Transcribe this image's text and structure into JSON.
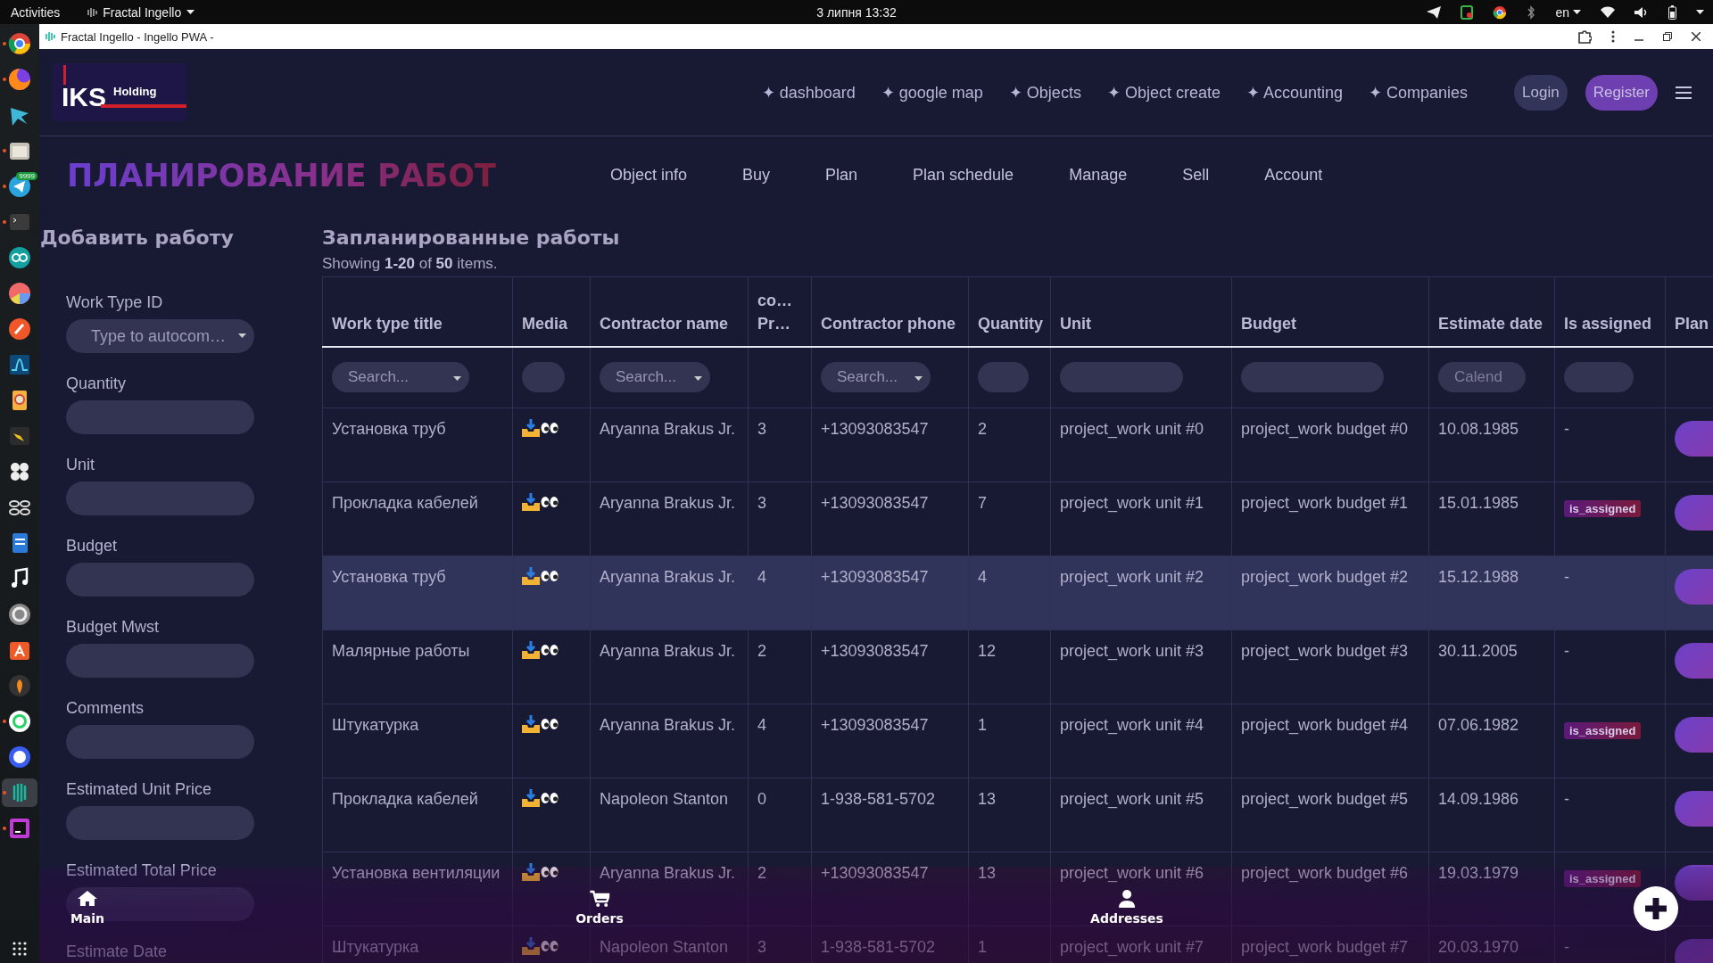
{
  "top_bar": {
    "activities": "Activities",
    "app_menu": "Fractal Ingello",
    "clock": "3 липня  13:32",
    "language": "en"
  },
  "dock": {
    "badge": "9999",
    "items": [
      {
        "running": true,
        "selected": false
      },
      {
        "running": true,
        "selected": false
      },
      {
        "running": false,
        "selected": false
      },
      {
        "running": true,
        "selected": false
      },
      {
        "running": true,
        "selected": false
      },
      {
        "running": true,
        "selected": false
      },
      {
        "running": false,
        "selected": false
      },
      {
        "running": false,
        "selected": false
      },
      {
        "running": false,
        "selected": false
      },
      {
        "running": false,
        "selected": false
      },
      {
        "running": false,
        "selected": false
      },
      {
        "running": false,
        "selected": false
      },
      {
        "running": false,
        "selected": false
      },
      {
        "running": false,
        "selected": false
      },
      {
        "running": false,
        "selected": false
      },
      {
        "running": false,
        "selected": false
      },
      {
        "running": false,
        "selected": false
      },
      {
        "running": false,
        "selected": false
      },
      {
        "running": false,
        "selected": false
      },
      {
        "running": true,
        "selected": false
      },
      {
        "running": false,
        "selected": false
      },
      {
        "running": true,
        "selected": true
      },
      {
        "running": true,
        "selected": false
      }
    ]
  },
  "window": {
    "title": "Fractal Ingello - Ingello PWA -"
  },
  "header": {
    "logo": {
      "main": "IKS",
      "sub": "Holding"
    },
    "nav": [
      "✦ dashboard",
      "✦ google map",
      "✦ Objects",
      "✦ Object create",
      "✦ Accounting",
      "✦ Companies"
    ],
    "buttons": [
      {
        "kind": "plain",
        "label": "Login"
      },
      {
        "kind": "primary",
        "label": "Register"
      }
    ]
  },
  "page": {
    "title": "ПЛАНИРОВАНИЕ РАБОТ",
    "tabs": [
      "Object info",
      "Buy",
      "Plan",
      "Plan schedule",
      "Manage",
      "Sell",
      "Account"
    ]
  },
  "form": {
    "title": "Добавить работу",
    "fields": [
      {
        "label": "Work Type ID",
        "kind": "select",
        "placeholder": "Type to autocom…"
      },
      {
        "label": "Quantity",
        "kind": "input"
      },
      {
        "label": "Unit",
        "kind": "input"
      },
      {
        "label": "Budget",
        "kind": "input"
      },
      {
        "label": "Budget Mwst",
        "kind": "input"
      },
      {
        "label": "Comments",
        "kind": "input"
      },
      {
        "label": "Estimated Unit Price",
        "kind": "input"
      },
      {
        "label": "Estimated Total Price",
        "kind": "input"
      },
      {
        "label": "Estimate Date",
        "kind": "none"
      }
    ]
  },
  "table": {
    "title": "Запланированные работы",
    "summary": "Showing **1-20** of **50** items.",
    "columns": [
      {
        "label": "Work type title",
        "filter": {
          "kind": "select",
          "placeholder": "Search..."
        }
      },
      {
        "label": "Media",
        "filter": {
          "kind": "input"
        }
      },
      {
        "label": "Contractor name",
        "filter": {
          "kind": "select",
          "placeholder": "Search..."
        }
      },
      {
        "label": "co…\nPr…",
        "filter": {
          "kind": "none"
        }
      },
      {
        "label": "Contractor phone",
        "filter": {
          "kind": "select",
          "placeholder": "Search..."
        }
      },
      {
        "label": "Quantity",
        "filter": {
          "kind": "input"
        }
      },
      {
        "label": "Unit",
        "filter": {
          "kind": "input"
        }
      },
      {
        "label": "Budget",
        "filter": {
          "kind": "input"
        }
      },
      {
        "label": "Estimate date",
        "filter": {
          "kind": "input",
          "placeholder": "Calend"
        }
      },
      {
        "label": "Is assigned",
        "filter": {
          "kind": "input"
        }
      },
      {
        "label": "Plan",
        "filter": {
          "kind": "none"
        }
      }
    ],
    "rows": [
      {
        "highlighted": false,
        "title": "Установка труб",
        "contractor": "Aryanna Brakus Jr.",
        "column_4": "3",
        "phone": "+13093083547",
        "quantity": "2",
        "unit": "project_work unit #0",
        "budget": "project_work budget #0",
        "date": "10.08.1985",
        "assigned": {
          "kind": "text",
          "text": "-"
        }
      },
      {
        "highlighted": false,
        "title": "Прокладка кабелей",
        "contractor": "Aryanna Brakus Jr.",
        "column_4": "3",
        "phone": "+13093083547",
        "quantity": "7",
        "unit": "project_work unit #1",
        "budget": "project_work budget #1",
        "date": "15.01.1985",
        "assigned": {
          "kind": "badge",
          "text": "is_assigned"
        }
      },
      {
        "highlighted": true,
        "title": "Установка труб",
        "contractor": "Aryanna Brakus Jr.",
        "column_4": "4",
        "phone": "+13093083547",
        "quantity": "4",
        "unit": "project_work unit #2",
        "budget": "project_work budget #2",
        "date": "15.12.1988",
        "assigned": {
          "kind": "text",
          "text": "-"
        }
      },
      {
        "highlighted": false,
        "title": "Малярные работы",
        "contractor": "Aryanna Brakus Jr.",
        "column_4": "2",
        "phone": "+13093083547",
        "quantity": "12",
        "unit": "project_work unit #3",
        "budget": "project_work budget #3",
        "date": "30.11.2005",
        "assigned": {
          "kind": "text",
          "text": "-"
        }
      },
      {
        "highlighted": false,
        "title": "Штукатурка",
        "contractor": "Aryanna Brakus Jr.",
        "column_4": "4",
        "phone": "+13093083547",
        "quantity": "1",
        "unit": "project_work unit #4",
        "budget": "project_work budget #4",
        "date": "07.06.1982",
        "assigned": {
          "kind": "badge",
          "text": "is_assigned"
        }
      },
      {
        "highlighted": false,
        "title": "Прокладка кабелей",
        "contractor": "Napoleon Stanton",
        "column_4": "0",
        "phone": "1-938-581-5702",
        "quantity": "13",
        "unit": "project_work unit #5",
        "budget": "project_work budget #5",
        "date": "14.09.1986",
        "assigned": {
          "kind": "text",
          "text": "-"
        }
      },
      {
        "highlighted": false,
        "title": "Установка вентиляции",
        "contractor": "Aryanna Brakus Jr.",
        "column_4": "2",
        "phone": "+13093083547",
        "quantity": "13",
        "unit": "project_work unit #6",
        "budget": "project_work budget #6",
        "date": "19.03.1979",
        "assigned": {
          "kind": "badge",
          "text": "is_assigned"
        }
      },
      {
        "highlighted": false,
        "title": "Штукатурка",
        "contractor": "Napoleon Stanton",
        "column_4": "3",
        "phone": "1-938-581-5702",
        "quantity": "1",
        "unit": "project_work unit #7",
        "budget": "project_work budget #7",
        "date": "20.03.1970",
        "assigned": {
          "kind": "text",
          "text": "-"
        }
      }
    ]
  },
  "bottom_nav": [
    {
      "kind": "home",
      "label": "Main"
    },
    {
      "kind": "cart",
      "label": "Orders"
    },
    {
      "kind": "person",
      "label": "Addresses"
    },
    {
      "kind": "add"
    }
  ]
}
